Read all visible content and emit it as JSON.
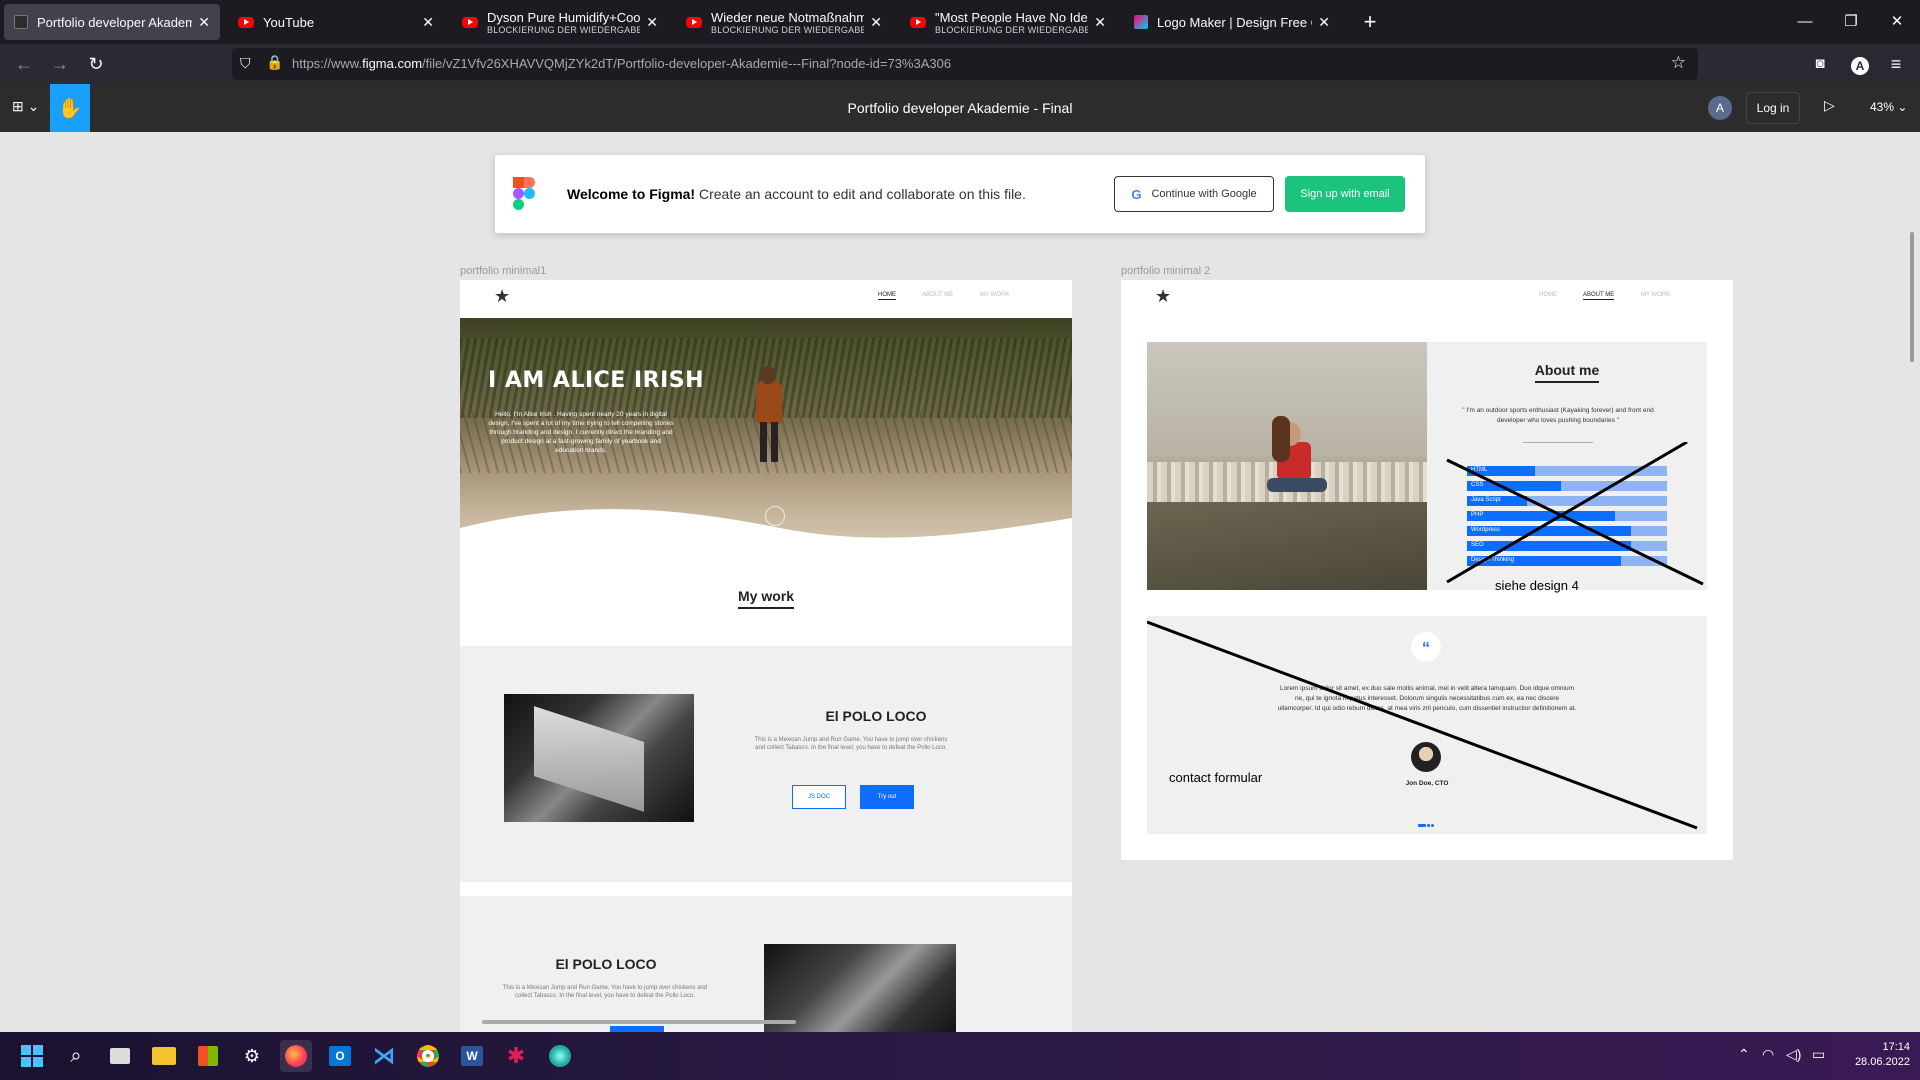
{
  "browser": {
    "tabs": [
      {
        "title": "Portfolio developer Akademie - F",
        "subtitle": "",
        "active": true
      },
      {
        "title": "YouTube",
        "subtitle": ""
      },
      {
        "title": "Dyson Pure Humidify+Cool nac",
        "subtitle": "BLOCKIERUNG DER WIEDERGABE"
      },
      {
        "title": "Wieder neue Notmaßnahmen!",
        "subtitle": "BLOCKIERUNG DER WIEDERGABE"
      },
      {
        "title": "\"Most People Have No Idea Wh",
        "subtitle": "BLOCKIERUNG DER WIEDERGABE"
      },
      {
        "title": "Logo Maker | Design Free Custo",
        "subtitle": ""
      }
    ],
    "url_prefix": "https://www.",
    "url_domain": "figma.com",
    "url_rest": "/file/vZ1Vfv26XHAVVQMjZYk2dT/Portfolio-developer-Akademie---Final?node-id=73%3A306"
  },
  "figma": {
    "doc_title": "Portfolio developer Akademie - Final",
    "avatar_letter": "A",
    "login_label": "Log in",
    "zoom": "43%"
  },
  "banner": {
    "welcome_bold": "Welcome to Figma!",
    "welcome_text": " Create an account to edit and collaborate on this file.",
    "google_btn": "Continue with Google",
    "email_btn": "Sign up with email"
  },
  "frame1": {
    "label": "portfolio minimal1",
    "nav": [
      "HOME",
      "ABOUT ME",
      "MY WORK"
    ],
    "hero_title": "I AM ALICE IRISH",
    "hero_text": "Hello, I'm Alice Irish . Having spent nearly 20 years in digital design, I've spent a lot of my time trying to tell compelling stories through branding and design. I currently direct the branding and product design at a fast-growing family of yearbook and education brands.",
    "mywork_title": "My work",
    "project1_title": "El POLO LOCO",
    "project1_text": "This is a Mexican Jump and Run Game. You have to jump over chickens and collect Tabasco. In the final level, you have to defeat the Pollo Loco.",
    "project1_btn1": "JS DOC",
    "project1_btn2": "Try out",
    "project2_title": "El POLO LOCO",
    "project2_text": "This is a Mexican Jump and Run Game. You have to jump over chickens and collect Tabasco. In the final level, you have to defeat the Pollo Loco."
  },
  "frame2": {
    "label": "portfolio minimal 2",
    "nav": [
      "HOME",
      "ABOUT ME",
      "MY WORK"
    ],
    "about_title": "About me",
    "about_quote": "\" I'm an outdoor sports enthusiast (Kayaking forever) and front end developer who loves pushing boundaries \"",
    "skills": [
      {
        "name": "HTML",
        "level": 0.34
      },
      {
        "name": "CSS",
        "level": 0.47
      },
      {
        "name": "Java Script",
        "level": 0.3
      },
      {
        "name": "PHP",
        "level": 0.74
      },
      {
        "name": "Wordpress",
        "level": 0.82
      },
      {
        "name": "SEO",
        "level": 0.82
      },
      {
        "name": "Design Thinking",
        "level": 0.77
      }
    ],
    "annotation1": "siehe design 4",
    "testimonial_text": "Lorem ipsum dolor sit amet, ex duo sale mollis animal, mei in velit altera tamquam. Duo idque omnium ne, qui te ignota impetus interesset. Dolorum singulis necessitatibus cum ex, ea nec discere ullamcorper. Id qui odio rebum dictas, at mea viris zril periculo, cum dissentiet instructior definitionem at.",
    "testimonial_name": "Jon Doe, CTO",
    "annotation2": "contact formular"
  },
  "taskbar": {
    "time": "17:14",
    "date": "28.06.2022"
  },
  "colors": {
    "accent_blue": "#0d6efd",
    "figma_blue": "#18a0fb",
    "figma_green": "#1bc47d"
  }
}
